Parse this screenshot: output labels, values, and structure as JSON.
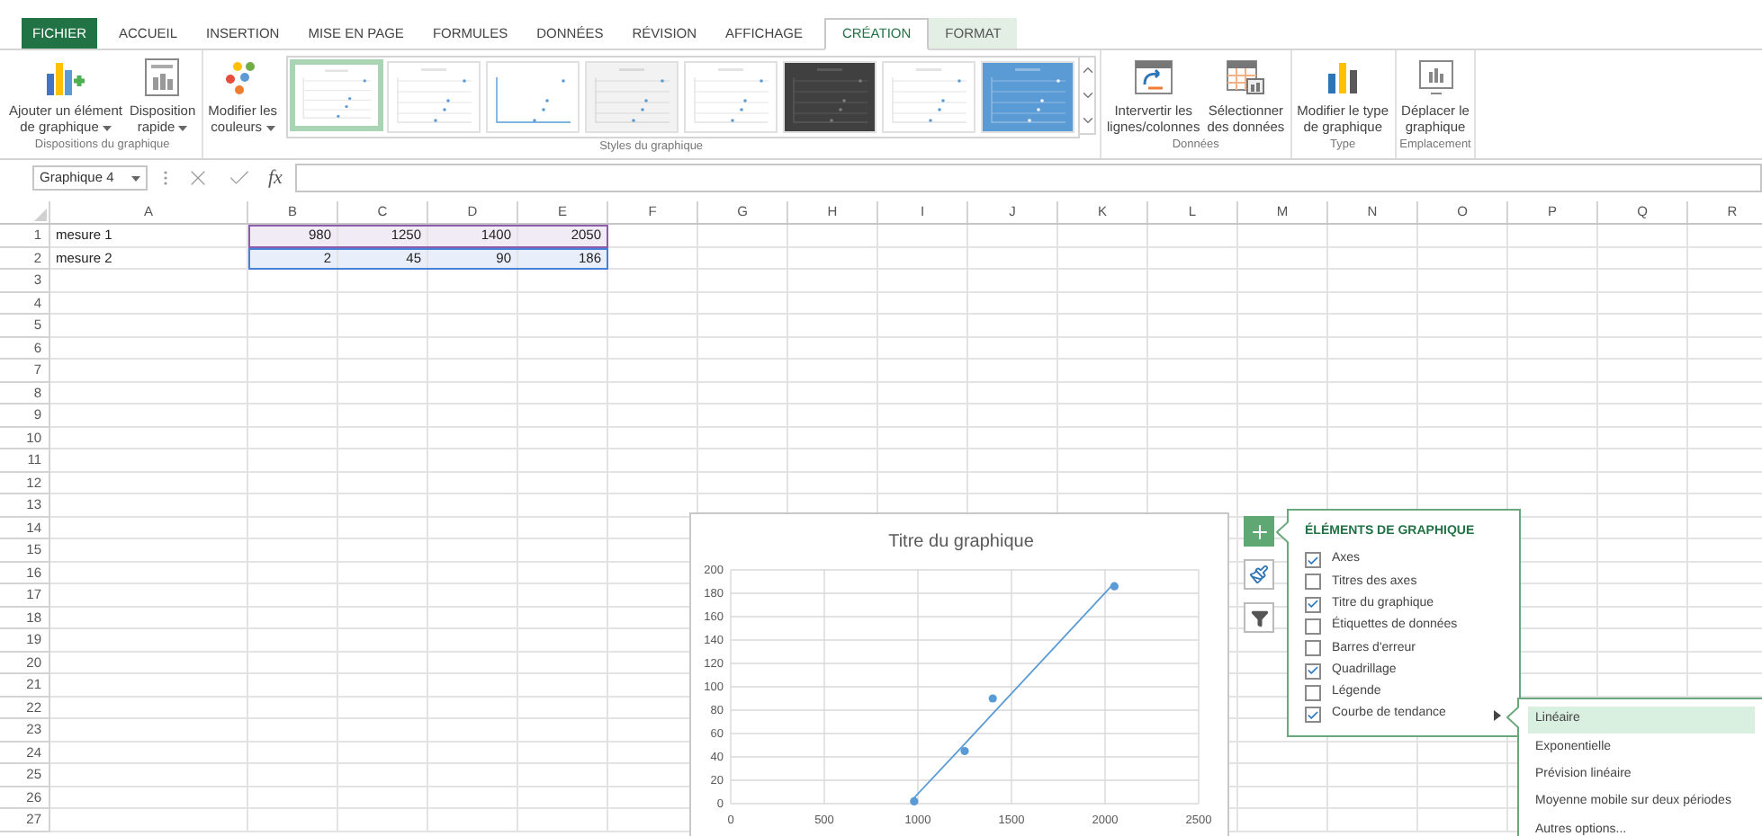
{
  "tabs": [
    {
      "label": "FICHIER",
      "kind": "file",
      "selected": false
    },
    {
      "label": "ACCUEIL",
      "kind": "normal",
      "selected": false
    },
    {
      "label": "INSERTION",
      "kind": "normal",
      "selected": false
    },
    {
      "label": "MISE EN PAGE",
      "kind": "normal",
      "selected": false
    },
    {
      "label": "FORMULES",
      "kind": "normal",
      "selected": false
    },
    {
      "label": "DONNÉES",
      "kind": "normal",
      "selected": false
    },
    {
      "label": "RÉVISION",
      "kind": "normal",
      "selected": false
    },
    {
      "label": "AFFICHAGE",
      "kind": "normal",
      "selected": false
    },
    {
      "label": "CRÉATION",
      "kind": "contextual",
      "selected": true
    },
    {
      "label": "FORMAT",
      "kind": "contextual",
      "selected": false
    }
  ],
  "ribbon_groups": [
    {
      "label": "Dispositions du graphique",
      "buttons": [
        {
          "label": "Ajouter un élément\nde graphique",
          "kind": "add_element",
          "dropdown": true
        },
        {
          "label": "Disposition\nrapide",
          "kind": "layout",
          "dropdown": true
        }
      ]
    },
    {
      "label": "Styles du graphique",
      "buttons": [
        {
          "label": "Modifier les\ncouleurs",
          "kind": "colors",
          "dropdown": true
        }
      ],
      "gallery": [
        {
          "kind": "light",
          "selected": true
        },
        {
          "kind": "light",
          "selected": false
        },
        {
          "kind": "axis",
          "selected": false
        },
        {
          "kind": "gray",
          "selected": false
        },
        {
          "kind": "light",
          "selected": false
        },
        {
          "kind": "dark",
          "selected": false
        },
        {
          "kind": "light",
          "selected": false
        },
        {
          "kind": "blue",
          "selected": false
        }
      ]
    },
    {
      "label": "Données",
      "buttons": [
        {
          "label": "Intervertir les\nlignes/colonnes",
          "kind": "switch",
          "dropdown": false
        },
        {
          "label": "Sélectionner\ndes données",
          "kind": "select_data",
          "dropdown": false
        }
      ]
    },
    {
      "label": "Type",
      "buttons": [
        {
          "label": "Modifier le type\nde graphique",
          "kind": "chart_type",
          "dropdown": false
        }
      ]
    },
    {
      "label": "Emplacement",
      "buttons": [
        {
          "label": "Déplacer le\ngraphique",
          "kind": "move",
          "dropdown": false
        }
      ]
    }
  ],
  "name_box": "Graphique 4",
  "formula_bar": {
    "function_label": "fx"
  },
  "columns": [
    "A",
    "B",
    "C",
    "D",
    "E",
    "F",
    "G",
    "H",
    "I",
    "J",
    "K",
    "L",
    "M",
    "N",
    "O",
    "P",
    "Q",
    "R"
  ],
  "rows": [
    {
      "number": "1",
      "cells": [
        "mesure 1",
        "980",
        "1250",
        "1400",
        "2050"
      ],
      "color": "#8e5cad"
    },
    {
      "number": "2",
      "cells": [
        "mesure 2",
        "2",
        "45",
        "90",
        "186"
      ],
      "color": "#4a7fd6"
    },
    {
      "number": "3"
    },
    {
      "number": "4"
    },
    {
      "number": "5"
    },
    {
      "number": "6"
    },
    {
      "number": "7"
    },
    {
      "number": "8"
    },
    {
      "number": "9"
    },
    {
      "number": "10"
    },
    {
      "number": "11"
    },
    {
      "number": "12"
    },
    {
      "number": "13"
    },
    {
      "number": "14"
    },
    {
      "number": "15"
    },
    {
      "number": "16"
    },
    {
      "number": "17"
    },
    {
      "number": "18"
    },
    {
      "number": "19"
    },
    {
      "number": "20"
    },
    {
      "number": "21"
    },
    {
      "number": "22"
    },
    {
      "number": "23"
    },
    {
      "number": "24"
    },
    {
      "number": "25"
    },
    {
      "number": "26"
    },
    {
      "number": "27"
    }
  ],
  "chart": {
    "chart_data": {
      "type": "scatter",
      "title": "Titre du graphique",
      "x": [
        980,
        1250,
        1400,
        2050
      ],
      "series": [
        {
          "type": "scatter",
          "color": "#5b9bd5",
          "values": [
            2,
            45,
            90,
            186
          ]
        },
        {
          "type": "line",
          "color": "#5b9bd5",
          "values": [
            5,
            51,
            77,
            189
          ]
        }
      ],
      "grid": true,
      "xlim": [
        0,
        2500
      ],
      "ylim": [
        0,
        200
      ],
      "xticks": [
        0,
        500,
        1000,
        1500,
        2000,
        2500
      ],
      "yticks": [
        0,
        20,
        40,
        60,
        80,
        100,
        120,
        140,
        160,
        180,
        200
      ]
    }
  },
  "chart_buttons": [
    {
      "kind": "elements",
      "selected": true
    },
    {
      "kind": "styles",
      "selected": false
    },
    {
      "kind": "filter",
      "selected": false
    }
  ],
  "elements_panel": {
    "title": "ÉLÉMENTS DE GRAPHIQUE",
    "items": [
      {
        "label": "Axes",
        "kind": "axes",
        "checked": true,
        "submenu": false
      },
      {
        "label": "Titres des axes",
        "kind": "axis_titles",
        "checked": false,
        "submenu": false
      },
      {
        "label": "Titre du graphique",
        "kind": "title",
        "checked": true,
        "submenu": false
      },
      {
        "label": "Étiquettes de données",
        "kind": "data_labels",
        "checked": false,
        "submenu": false
      },
      {
        "label": "Barres d'erreur",
        "kind": "error_bars",
        "checked": false,
        "submenu": false
      },
      {
        "label": "Quadrillage",
        "kind": "gridlines",
        "checked": true,
        "submenu": false
      },
      {
        "label": "Légende",
        "kind": "legend",
        "checked": false,
        "submenu": false
      },
      {
        "label": "Courbe de tendance",
        "kind": "trendline",
        "checked": true,
        "submenu": true
      }
    ]
  },
  "trendline_menu": {
    "items": [
      {
        "label": "Linéaire",
        "selected": true
      },
      {
        "label": "Exponentielle",
        "selected": false
      },
      {
        "label": "Prévision linéaire",
        "selected": false
      },
      {
        "label": "Moyenne mobile sur deux périodes",
        "selected": false
      },
      {
        "label": "Autres options...",
        "selected": false
      }
    ]
  }
}
